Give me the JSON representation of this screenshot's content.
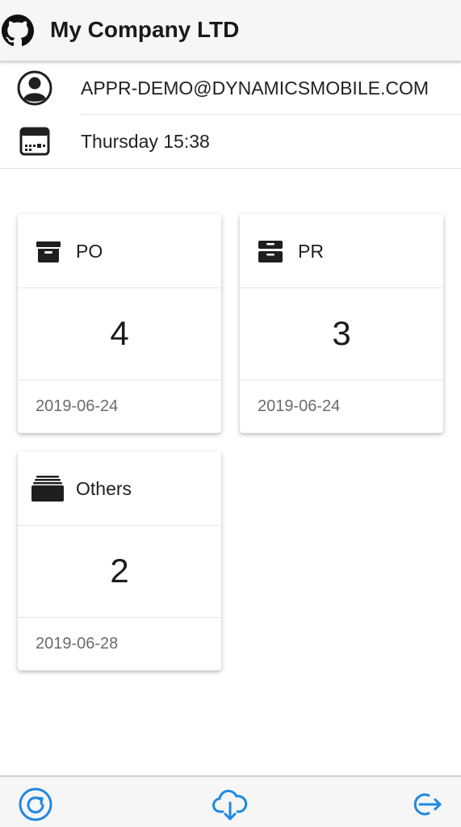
{
  "header": {
    "title": "My Company LTD",
    "logo_icon": "github-icon"
  },
  "user": {
    "email": "APPR-DEMO@DYNAMICSMOBILE.COM",
    "icon": "user-avatar-icon"
  },
  "datetime": {
    "text": "Thursday 15:38",
    "icon": "calendar-icon"
  },
  "cards": [
    {
      "label": "PO",
      "count": "4",
      "date": "2019-06-24",
      "icon": "archive-box-icon"
    },
    {
      "label": "PR",
      "count": "3",
      "date": "2019-06-24",
      "icon": "inbox-tray-icon"
    },
    {
      "label": "Others",
      "count": "2",
      "date": "2019-06-28",
      "icon": "stacked-folders-icon"
    }
  ],
  "bottom_bar": {
    "buttons": [
      {
        "icon": "refresh-icon"
      },
      {
        "icon": "cloud-download-icon"
      },
      {
        "icon": "logout-icon"
      }
    ]
  },
  "colors": {
    "accent": "#1e88e5",
    "icon_dark": "#1f1f1f",
    "header_bg": "#f6f6f6"
  }
}
